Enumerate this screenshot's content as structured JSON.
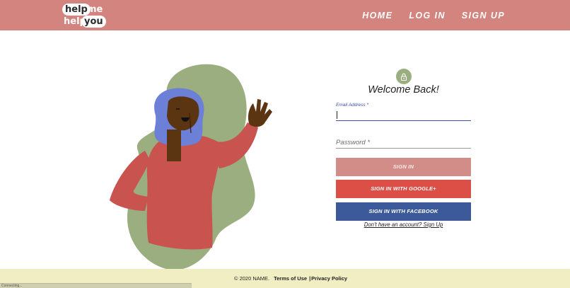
{
  "brand": {
    "logo_words": [
      "help",
      "me",
      "help",
      "you"
    ]
  },
  "nav": {
    "items": [
      "HOME",
      "LOG IN",
      "SIGN UP"
    ]
  },
  "login": {
    "icon": "lock-icon",
    "title": "Welcome Back!",
    "email_label": "Email Address *",
    "email_value": "",
    "password_placeholder": "Password *",
    "signin_label": "SIGN IN",
    "google_label": "SIGN IN WITH GOOGLE+",
    "facebook_label": "SIGN IN WITH FACEBOOK",
    "signup_text": "Don't have an account? Sign Up"
  },
  "footer": {
    "copyright": "© 2020 NAME.",
    "terms": "Terms of Use",
    "separator": "|",
    "privacy": "Privacy Policy"
  },
  "status": {
    "text": "Connecting..."
  },
  "colors": {
    "header": "#d4847f",
    "blob": "#9aae7f",
    "shirt": "#c9534e",
    "hair": "#6b80d6",
    "skin": "#5b3412",
    "google": "#dc4f46",
    "facebook": "#3c5a99",
    "signin": "#d38d88",
    "footer": "#f0eec2"
  }
}
